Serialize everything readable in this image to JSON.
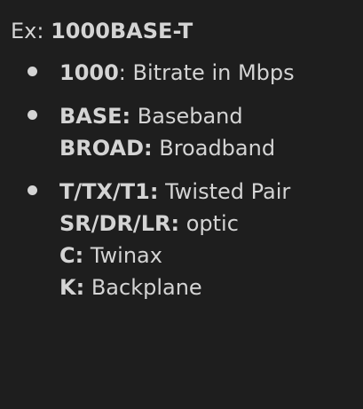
{
  "title": {
    "prefix": "Ex: ",
    "value": "1000BASE-T"
  },
  "bullets": [
    {
      "lines": [
        {
          "term": "1000",
          "sep": ":",
          "desc": " Bitrate in Mbps"
        }
      ]
    },
    {
      "lines": [
        {
          "term": "BASE:",
          "sep": "",
          "desc": " Baseband"
        },
        {
          "term": "BROAD:",
          "sep": "",
          "desc": " Broadband"
        }
      ]
    },
    {
      "lines": [
        {
          "term": "T/TX/T1:",
          "sep": "",
          "desc": " Twisted Pair"
        },
        {
          "term": "SR/DR/LR:",
          "sep": "",
          "desc": " optic"
        },
        {
          "term": "C:",
          "sep": "",
          "desc": " Twinax"
        },
        {
          "term": "K:",
          "sep": "",
          "desc": " Backplane"
        }
      ]
    }
  ]
}
